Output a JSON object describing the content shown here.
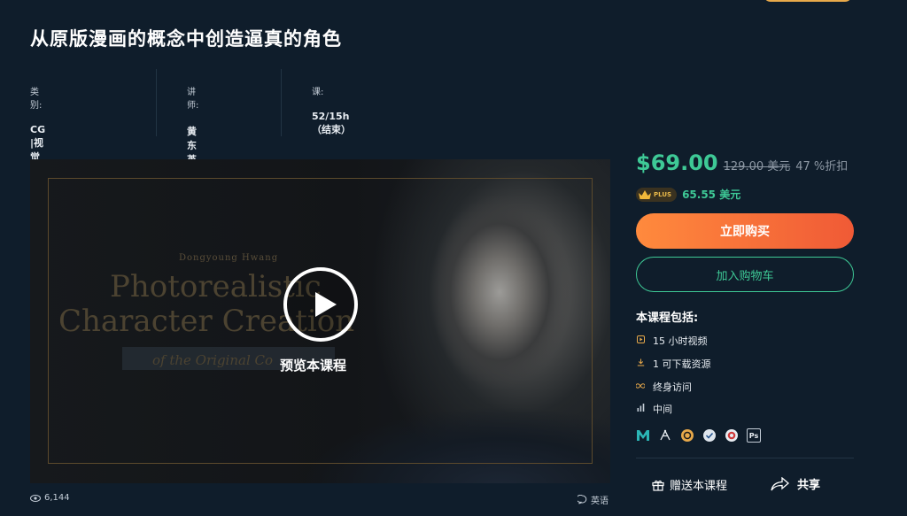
{
  "course": {
    "title": "从原版漫画的概念中创造逼真的角色",
    "meta": [
      {
        "label": "类别:",
        "value": "CG |视觉特效"
      },
      {
        "label": "讲师:",
        "value": "黄东英"
      },
      {
        "label": "课:",
        "value": "52/15h （结束）"
      }
    ]
  },
  "video": {
    "artist": "Dongyoung Hwang",
    "line1": "Photorealistic",
    "line2": "Character Creation",
    "line3": "of the Original Co",
    "preview_label": "预览本课程",
    "views": "6,144",
    "language": "英语"
  },
  "pricing": {
    "price": "$69.00",
    "original": "129.00 美元",
    "discount": "47 %折扣",
    "plus_badge": "PLUS",
    "plus_price": "65.55 美元",
    "buy_label": "立即购买",
    "cart_label": "加入购物车"
  },
  "includes": {
    "heading": "本课程包括:",
    "items": [
      {
        "icon": "play-icon",
        "text": "15 小时视频"
      },
      {
        "icon": "download-icon",
        "text": "1 可下载资源"
      },
      {
        "icon": "infinity-icon",
        "text": "终身访问"
      },
      {
        "icon": "level-bars-icon",
        "text": "中间"
      }
    ],
    "tools": [
      "maya-icon",
      "zbrush-icon",
      "substance-icon",
      "marmoset-icon",
      "arnold-icon",
      "photoshop-icon"
    ],
    "tool_ps": "Ps"
  },
  "actions": {
    "gift_label": "赠送本课程",
    "share_label": "共享"
  },
  "colors": {
    "background": "#0f1d2b",
    "accent_green": "#3ec996",
    "buy_gradient_start": "#ff8a3d",
    "buy_gradient_end": "#f05a36",
    "orange_icon": "#e8a94a"
  }
}
